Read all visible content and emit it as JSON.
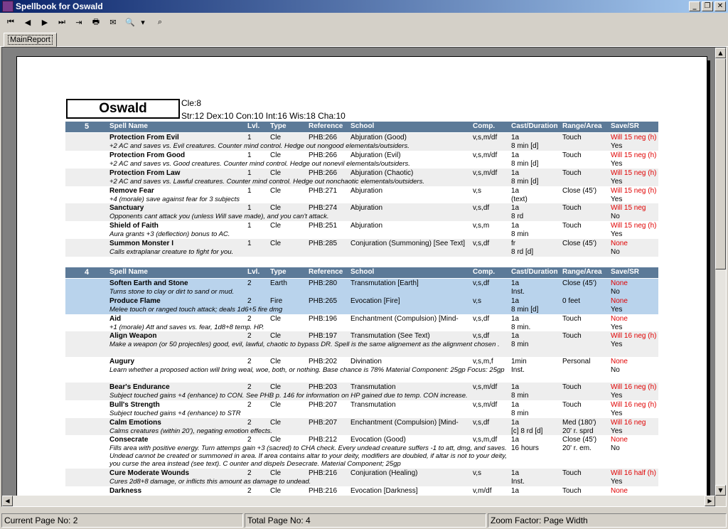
{
  "window": {
    "title": "Spellbook for Oswald",
    "min": "_",
    "max": "❐",
    "close": "✕"
  },
  "toolbar": {
    "first": "⏮",
    "prev": "◀",
    "next": "▶",
    "last": "⏭",
    "goto": "⇥",
    "print": "🖶",
    "export": "✉",
    "zoom": "🔍",
    "zoom_drop": "▾",
    "find": "⌕"
  },
  "tab": {
    "label": "MainReport"
  },
  "character": {
    "name": "Oswald",
    "class_line": "Cle:8",
    "stats_line": "Str:12 Dex:10 Con:10 Int:16 Wis:18 Cha:10"
  },
  "headers": {
    "name": "Spell Name",
    "lvl": "Lvl.",
    "type": "Type",
    "ref": "Reference",
    "school": "School",
    "comp": "Comp.",
    "cast": "Cast/Duration",
    "range": "Range/Area",
    "save": "Save/SR"
  },
  "groups": [
    {
      "count": "5",
      "spells": [
        {
          "name": "Protection From Evil",
          "lvl": "1",
          "type": "Cle",
          "ref": "PHB:266",
          "school": "Abjuration (Good)",
          "comp": "v,s,m/df",
          "cast": "1a",
          "dur": "8 min [d]",
          "range": "Touch",
          "area": "",
          "save": "Will 15 neg (h)",
          "sr": "Yes",
          "desc": "+2 AC and saves vs. Evil creatures. Counter mind control. Hedge out nongood elementals/outsiders."
        },
        {
          "name": "Protection From Good",
          "lvl": "1",
          "type": "Cle",
          "ref": "PHB:266",
          "school": "Abjuration (Evil)",
          "comp": "v,s,m/df",
          "cast": "1a",
          "dur": "8 min [d]",
          "range": "Touch",
          "area": "",
          "save": "Will 15 neg (h)",
          "sr": "Yes",
          "desc": "+2 AC and saves vs. Good creatures. Counter mind control. Hedge out nonevil elementals/outsiders."
        },
        {
          "name": "Protection From Law",
          "lvl": "1",
          "type": "Cle",
          "ref": "PHB:266",
          "school": "Abjuration (Chaotic)",
          "comp": "v,s,m/df",
          "cast": "1a",
          "dur": "8 min [d]",
          "range": "Touch",
          "area": "",
          "save": "Will 15 neg (h)",
          "sr": "Yes",
          "desc": "+2 AC and saves vs. Lawful creatures. Counter mind control. Hedge out nonchaotic elementals/outsiders."
        },
        {
          "name": "Remove Fear",
          "lvl": "1",
          "type": "Cle",
          "ref": "PHB:271",
          "school": "Abjuration",
          "comp": "v,s",
          "cast": "1a",
          "dur": "(text)",
          "range": "Close (45')",
          "area": "",
          "save": "Will 15 neg (h)",
          "sr": "Yes",
          "desc": "+4 (morale) save against fear for 3 subjects"
        },
        {
          "name": "Sanctuary",
          "lvl": "1",
          "type": "Cle",
          "ref": "PHB:274",
          "school": "Abjuration",
          "comp": "v,s,df",
          "cast": "1a",
          "dur": "8 rd",
          "range": "Touch",
          "area": "",
          "save": "Will 15 neg",
          "sr": "No",
          "desc": "Opponents cant attack you (unless Will save made), and you can't attack."
        },
        {
          "name": "Shield of Faith",
          "lvl": "1",
          "type": "Cle",
          "ref": "PHB:251",
          "school": "Abjuration",
          "comp": "v,s,m",
          "cast": "1a",
          "dur": "8 min",
          "range": "Touch",
          "area": "",
          "save": "Will 15 neg (h)",
          "sr": "Yes",
          "desc": "Aura grants +3 (deflection) bonus to AC."
        },
        {
          "name": "Summon Monster I",
          "lvl": "1",
          "type": "Cle",
          "ref": "PHB:285",
          "school": "Conjuration (Summoning) [See Text]",
          "comp": "v,s,df",
          "cast": "fr",
          "dur": "8 rd [d]",
          "range": "Close (45')",
          "area": "",
          "save": "None",
          "sr": "No",
          "desc": "Calls extraplanar creature to fight for you."
        }
      ]
    },
    {
      "count": "4",
      "spells": [
        {
          "name": "Soften Earth and Stone",
          "lvl": "2",
          "type": "Earth",
          "ref": "PHB:280",
          "school": "Transmutation [Earth]",
          "comp": "v,s,df",
          "cast": "1a",
          "dur": "Inst.",
          "range": "Close (45')",
          "area": "",
          "save": "None",
          "sr": "No",
          "desc": "Turns stone to clay or dirt to sand or mud."
        },
        {
          "name": "Produce Flame",
          "lvl": "2",
          "type": "Fire",
          "ref": "PHB:265",
          "school": "Evocation [Fire]",
          "comp": "v,s",
          "cast": "1a",
          "dur": "8 min [d]",
          "range": "0 feet",
          "area": "",
          "save": "None",
          "sr": "Yes",
          "desc": "Melee touch or ranged touch attack; deals 1d6+5 fire dmg"
        },
        {
          "name": "Aid",
          "lvl": "2",
          "type": "Cle",
          "ref": "PHB:196",
          "school": "Enchantment (Compulsion) [Mind-",
          "comp": "v,s,df",
          "cast": "1a",
          "dur": "8 min.",
          "range": "Touch",
          "area": "",
          "save": "None",
          "sr": "Yes",
          "desc": "+1 (morale) Att and saves vs. fear, 1d8+8 temp. HP."
        },
        {
          "name": "Align Weapon",
          "lvl": "2",
          "type": "Cle",
          "ref": "PHB:197",
          "school": "Transmutation (See Text)",
          "comp": "v,s,df",
          "cast": "1a",
          "dur": "8 min",
          "range": "Touch",
          "area": "",
          "save": "Will 16 neg (h)",
          "sr": "Yes",
          "desc": "Make a weapon (or 50 projectiles) good, evil, lawful, chaotic to bypass DR. Spell is the same alignement as the alignment chosen ."
        },
        {
          "name": "Augury",
          "lvl": "2",
          "type": "Cle",
          "ref": "PHB:202",
          "school": "Divination",
          "comp": "v,s,m,f",
          "cast": "1min",
          "dur": "Inst.",
          "range": "Personal",
          "area": "",
          "save": "None",
          "sr": "No",
          "desc": "Learn whether a proposed action will bring weal, woe, both, or nothing. Base chance is 78% Material Component: 25gp Focus: 25gp"
        },
        {
          "name": "Bear's Endurance",
          "lvl": "2",
          "type": "Cle",
          "ref": "PHB:203",
          "school": "Transmutation",
          "comp": "v,s,m/df",
          "cast": "1a",
          "dur": "8 min",
          "range": "Touch",
          "area": "",
          "save": "Will 16 neg (h)",
          "sr": "Yes",
          "desc": "Subject touched gains +4 (enhance) to CON. See PHB p. 146 for information on HP gained due to temp. CON increase."
        },
        {
          "name": "Bull's Strength",
          "lvl": "2",
          "type": "Cle",
          "ref": "PHB:207",
          "school": "Transmutation",
          "comp": "v,s,m/df",
          "cast": "1a",
          "dur": "8 min",
          "range": "Touch",
          "area": "",
          "save": "Will 16 neg (h)",
          "sr": "Yes",
          "desc": "Subject touched gains +4 (enhance) to STR"
        },
        {
          "name": "Calm Emotions",
          "lvl": "2",
          "type": "Cle",
          "ref": "PHB:207",
          "school": "Enchantment (Compulsion) [Mind-",
          "comp": "v,s,df",
          "cast": "1a",
          "dur": "[c] 8 rd [d]",
          "range": "Med (180')",
          "area": "20' r. sprd",
          "save": "Will 16 neg",
          "sr": "Yes",
          "desc": "Calms creatures (within 20'), negating emotion effects."
        },
        {
          "name": "Consecrate",
          "lvl": "2",
          "type": "Cle",
          "ref": "PHB:212",
          "school": "Evocation (Good)",
          "comp": "v,s,m,df",
          "cast": "1a",
          "dur": "16 hours",
          "range": "Close (45')",
          "area": "20' r. em.",
          "save": "None",
          "sr": "No",
          "desc": "Fills area with positive energy. Turn attemps gain +3 (sacred) to CHA check. Every undead creature suffers -1 to att, dmg, and saves. Undead cannot be created or summoned in area. If area contains altar to your deity, modifiers are doubled, if altar is not to your deity, you curse the area instead (see text). C ounter and dispels Desecrate. Material Component; 25gp"
        },
        {
          "name": "Cure Moderate Wounds",
          "lvl": "2",
          "type": "Cle",
          "ref": "PHB:216",
          "school": "Conjuration (Healing)",
          "comp": "v,s",
          "cast": "1a",
          "dur": "Inst.",
          "range": "Touch",
          "area": "",
          "save": "Will 16 half (h)",
          "sr": "Yes",
          "desc": "Cures 2d8+8 damage, or inflicts this amount as damage to undead."
        },
        {
          "name": "Darkness",
          "lvl": "2",
          "type": "Cle",
          "ref": "PHB:216",
          "school": "Evocation [Darkness]",
          "comp": "v,m/df",
          "cast": "1a",
          "dur": "",
          "range": "Touch",
          "area": "",
          "save": "None",
          "sr": "",
          "desc": ""
        }
      ]
    }
  ],
  "status": {
    "current": "Current Page No: 2",
    "total": "Total Page No: 4",
    "zoom": "Zoom Factor: Page Width"
  }
}
